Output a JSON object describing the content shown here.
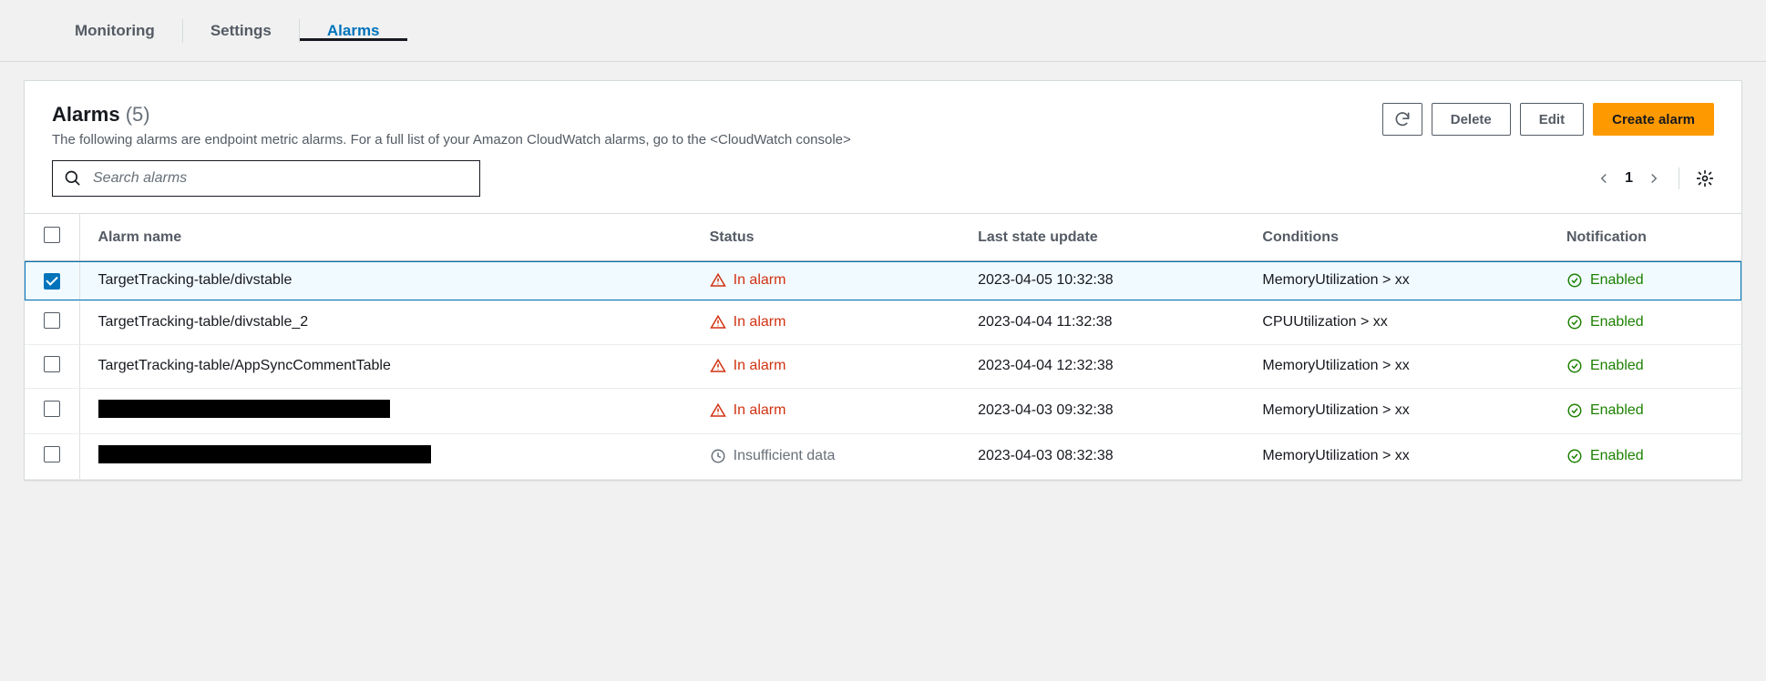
{
  "tabs": [
    {
      "label": "Monitoring",
      "active": false
    },
    {
      "label": "Settings",
      "active": false
    },
    {
      "label": "Alarms",
      "active": true
    }
  ],
  "header": {
    "title": "Alarms",
    "count_display": "(5)",
    "description_prefix": "The following alarms are endpoint metric alarms. For a full list of your Amazon CloudWatch alarms, go to the ",
    "description_link": "<CloudWatch console>"
  },
  "actions": {
    "refresh_title": "Refresh",
    "delete_label": "Delete",
    "edit_label": "Edit",
    "create_label": "Create alarm"
  },
  "search": {
    "placeholder": "Search alarms"
  },
  "pager": {
    "page": "1"
  },
  "columns": {
    "name": "Alarm name",
    "status": "Status",
    "last_update": "Last state update",
    "conditions": "Conditions",
    "notification": "Notification"
  },
  "status_labels": {
    "in_alarm": "In alarm",
    "insufficient": "Insufficient data"
  },
  "notification_label": "Enabled",
  "rows": [
    {
      "selected": true,
      "name": "TargetTracking-table/divstable",
      "redacted": false,
      "status": "in_alarm",
      "last_update": "2023-04-05 10:32:38",
      "conditions": "MemoryUtilization > xx",
      "notification": "enabled"
    },
    {
      "selected": false,
      "name": "TargetTracking-table/divstable_2",
      "redacted": false,
      "status": "in_alarm",
      "last_update": "2023-04-04 11:32:38",
      "conditions": "CPUUtilization > xx",
      "notification": "enabled"
    },
    {
      "selected": false,
      "name": "TargetTracking-table/AppSyncCommentTable",
      "redacted": false,
      "status": "in_alarm",
      "last_update": "2023-04-04 12:32:38",
      "conditions": "MemoryUtilization > xx",
      "notification": "enabled"
    },
    {
      "selected": false,
      "name": "",
      "redacted": true,
      "redacted_width": 320,
      "status": "in_alarm",
      "last_update": "2023-04-03 09:32:38",
      "conditions": "MemoryUtilization > xx",
      "notification": "enabled"
    },
    {
      "selected": false,
      "name": "",
      "redacted": true,
      "redacted_width": 365,
      "status": "insufficient",
      "last_update": "2023-04-03 08:32:38",
      "conditions": "MemoryUtilization > xx",
      "notification": "enabled"
    }
  ]
}
